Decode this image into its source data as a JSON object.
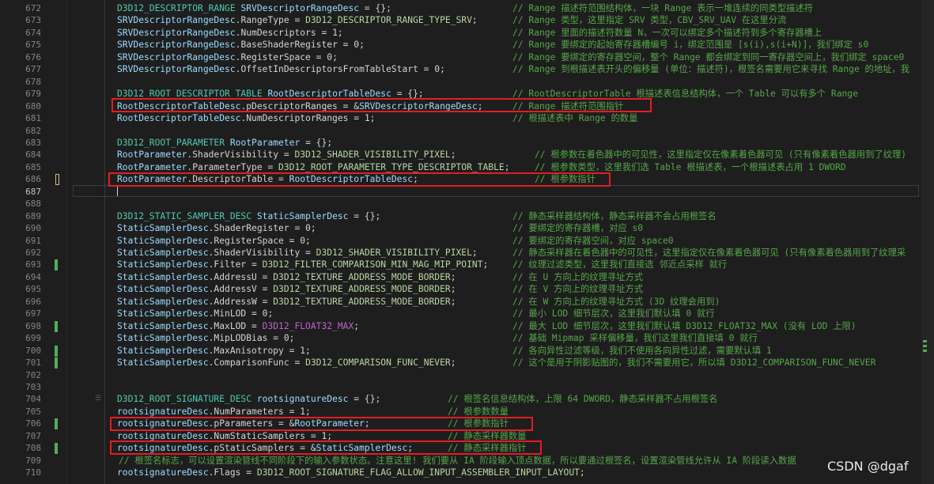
{
  "editor": {
    "lines": [
      {
        "n": "672",
        "tokens": [
          {
            "t": "D3D12_DESCRIPTOR_RANGE",
            "c": "type"
          },
          {
            "t": " "
          },
          {
            "t": "SRVDescriptorRangeDesc",
            "c": "def"
          },
          {
            "t": " = {};"
          }
        ],
        "comment": "// Range 描述符范围结构体，一块 Range 表示一堆连续的同类型描述符"
      },
      {
        "n": "673",
        "tokens": [
          {
            "t": "SRVDescriptorRangeDesc",
            "c": "var"
          },
          {
            "t": ".RangeType = "
          },
          {
            "t": "D3D12_DESCRIPTOR_RANGE_TYPE_SRV",
            "c": "const"
          },
          {
            "t": ";"
          }
        ],
        "comment": "// Range 类型，这里指定 SRV 类型，CBV_SRV_UAV 在这里分流"
      },
      {
        "n": "674",
        "tokens": [
          {
            "t": "SRVDescriptorRangeDesc",
            "c": "var"
          },
          {
            "t": ".NumDescriptors = 1;"
          }
        ],
        "comment": "// Range 里面的描述符数量 N，一次可以绑定多个描述符到多个寄存器槽上"
      },
      {
        "n": "675",
        "tokens": [
          {
            "t": "SRVDescriptorRangeDesc",
            "c": "var"
          },
          {
            "t": ".BaseShaderRegister = 0;"
          }
        ],
        "comment": "// Range 要绑定的起始寄存器槽编号 i，绑定范围是 [s(i),s(i+N)]，我们绑定 s0"
      },
      {
        "n": "676",
        "tokens": [
          {
            "t": "SRVDescriptorRangeDesc",
            "c": "var"
          },
          {
            "t": ".RegisterSpace = 0;"
          }
        ],
        "comment": "// Range 要绑定的寄存器空间，整个 Range 都会绑定到同一寄存器空间上，我们绑定 space0"
      },
      {
        "n": "677",
        "tokens": [
          {
            "t": "SRVDescriptorRangeDesc",
            "c": "var"
          },
          {
            "t": ".OffsetInDescriptorsFromTableStart = 0;"
          }
        ],
        "comment": "// Range 到根描述表开头的偏移量 (单位：描述符)，根签名需要用它来寻找 Range 的地址，我"
      },
      {
        "n": "678",
        "tokens": [],
        "comment": ""
      },
      {
        "n": "679",
        "tokens": [
          {
            "t": "D3D12_ROOT_DESCRIPTOR_TABLE",
            "c": "type"
          },
          {
            "t": " "
          },
          {
            "t": "RootDescriptorTableDesc",
            "c": "def"
          },
          {
            "t": " = {};"
          }
        ],
        "comment": "// RootDescriptorTable 根描述表信息结构体，一个 Table 可以有多个 Range"
      },
      {
        "n": "680",
        "tokens": [
          {
            "t": "RootDescriptorTableDesc",
            "c": "var"
          },
          {
            "t": ".pDescriptorRanges = &"
          },
          {
            "t": "SRVDescriptorRangeDesc",
            "c": "var"
          },
          {
            "t": ";"
          }
        ],
        "comment": "// Range 描述符范围指针"
      },
      {
        "n": "681",
        "tokens": [
          {
            "t": "RootDescriptorTableDesc",
            "c": "var"
          },
          {
            "t": ".NumDescriptorRanges = 1;"
          }
        ],
        "comment": "// 根描述表中 Range 的数量"
      },
      {
        "n": "682",
        "tokens": [],
        "comment": ""
      },
      {
        "n": "683",
        "tokens": [
          {
            "t": "D3D12_ROOT_PARAMETER",
            "c": "type"
          },
          {
            "t": " "
          },
          {
            "t": "RootParameter",
            "c": "def"
          },
          {
            "t": " = {};"
          }
        ],
        "comment": ""
      },
      {
        "n": "684",
        "tokens": [
          {
            "t": "RootParameter",
            "c": "var"
          },
          {
            "t": ".ShaderVisibility = "
          },
          {
            "t": "D3D12_SHADER_VISIBILITY_PIXEL",
            "c": "const"
          },
          {
            "t": ";"
          }
        ],
        "comment": "// 根参数在着色器中的可见性，这里指定仅在像素着色器可见 (只有像素着色器用到了纹理)"
      },
      {
        "n": "685",
        "tokens": [
          {
            "t": "RootParameter",
            "c": "var"
          },
          {
            "t": ".ParameterType = "
          },
          {
            "t": "D3D12_ROOT_PARAMETER_TYPE_DESCRIPTOR_TABLE",
            "c": "const"
          },
          {
            "t": ";"
          }
        ],
        "comment": "// 根参数类型，这里我们选 Table 根描述表，一个根描述表占用 1 DWORD"
      },
      {
        "n": "686",
        "tokens": [
          {
            "t": "RootParameter",
            "c": "var"
          },
          {
            "t": ".DescriptorTable = "
          },
          {
            "t": "RootDescriptorTableDesc",
            "c": "var"
          },
          {
            "t": ";"
          }
        ],
        "comment": "// 根参数指针"
      },
      {
        "n": "687",
        "tokens": [],
        "comment": ""
      },
      {
        "n": "688",
        "tokens": [],
        "comment": ""
      },
      {
        "n": "689",
        "tokens": [
          {
            "t": "D3D12_STATIC_SAMPLER_DESC",
            "c": "type"
          },
          {
            "t": " "
          },
          {
            "t": "StaticSamplerDesc",
            "c": "def"
          },
          {
            "t": " = {};"
          }
        ],
        "comment": "// 静态采样器结构体，静态采样器不会占用根签名"
      },
      {
        "n": "690",
        "tokens": [
          {
            "t": "StaticSamplerDesc",
            "c": "var"
          },
          {
            "t": ".ShaderRegister = 0;"
          }
        ],
        "comment": "// 要绑定的寄存器槽，对应 s0"
      },
      {
        "n": "691",
        "tokens": [
          {
            "t": "StaticSamplerDesc",
            "c": "var"
          },
          {
            "t": ".RegisterSpace = 0;"
          }
        ],
        "comment": "// 要绑定的寄存器空间，对应 space0"
      },
      {
        "n": "692",
        "tokens": [
          {
            "t": "StaticSamplerDesc",
            "c": "var"
          },
          {
            "t": ".ShaderVisibility = "
          },
          {
            "t": "D3D12_SHADER_VISIBILITY_PIXEL",
            "c": "const"
          },
          {
            "t": ";"
          }
        ],
        "comment": "// 静态采样器在着色器中的可见性，这里指定仅在像素着色器可见 (只有像素着色器用到了纹理采"
      },
      {
        "n": "693",
        "tokens": [
          {
            "t": "StaticSamplerDesc",
            "c": "var"
          },
          {
            "t": ".Filter = "
          },
          {
            "t": "D3D12_FILTER_COMPARISON_MIN_MAG_MIP_POINT",
            "c": "const"
          },
          {
            "t": ";"
          }
        ],
        "comment": "// 纹理过滤类型，这里我们直接选 邻近点采样 就行"
      },
      {
        "n": "694",
        "tokens": [
          {
            "t": "StaticSamplerDesc",
            "c": "var"
          },
          {
            "t": ".AddressU = "
          },
          {
            "t": "D3D12_TEXTURE_ADDRESS_MODE_BORDER",
            "c": "const"
          },
          {
            "t": ";"
          }
        ],
        "comment": "// 在 U 方向上的纹理寻址方式"
      },
      {
        "n": "695",
        "tokens": [
          {
            "t": "StaticSamplerDesc",
            "c": "var"
          },
          {
            "t": ".AddressV = "
          },
          {
            "t": "D3D12_TEXTURE_ADDRESS_MODE_BORDER",
            "c": "const"
          },
          {
            "t": ";"
          }
        ],
        "comment": "// 在 V 方向上的纹理寻址方式"
      },
      {
        "n": "696",
        "tokens": [
          {
            "t": "StaticSamplerDesc",
            "c": "var"
          },
          {
            "t": ".AddressW = "
          },
          {
            "t": "D3D12_TEXTURE_ADDRESS_MODE_BORDER",
            "c": "const"
          },
          {
            "t": ";"
          }
        ],
        "comment": "// 在 W 方向上的纹理寻址方式 (3D 纹理会用到)"
      },
      {
        "n": "697",
        "tokens": [
          {
            "t": "StaticSamplerDesc",
            "c": "var"
          },
          {
            "t": ".MinLOD = 0;"
          }
        ],
        "comment": "// 最小 LOD 细节层次，这里我们默认填 0 就行"
      },
      {
        "n": "698",
        "tokens": [
          {
            "t": "StaticSamplerDesc",
            "c": "var"
          },
          {
            "t": ".MaxLOD = "
          },
          {
            "t": "D3D12_FLOAT32_MAX",
            "c": "macro"
          },
          {
            "t": ";"
          }
        ],
        "comment": "// 最大 LOD 细节层次，这里我们默认填 D3D12_FLOAT32_MAX (没有 LOD 上限)"
      },
      {
        "n": "699",
        "tokens": [
          {
            "t": "StaticSamplerDesc",
            "c": "var"
          },
          {
            "t": ".MipLODBias = 0;"
          }
        ],
        "comment": "// 基础 Mipmap 采样偏移量，我们这里我们直接填 0 就行"
      },
      {
        "n": "700",
        "tokens": [
          {
            "t": "StaticSamplerDesc",
            "c": "var"
          },
          {
            "t": ".MaxAnisotropy = 1;"
          }
        ],
        "comment": "// 各向异性过滤等级，我们不使用各向异性过滤，需要默认填 1"
      },
      {
        "n": "701",
        "tokens": [
          {
            "t": "StaticSamplerDesc",
            "c": "var"
          },
          {
            "t": ".ComparisonFunc = "
          },
          {
            "t": "D3D12_COMPARISON_FUNC_NEVER",
            "c": "const"
          },
          {
            "t": ";"
          }
        ],
        "comment": "// 这个是用于阴影贴图的，我们不需要用它，所以填 D3D12_COMPARISON_FUNC_NEVER"
      },
      {
        "n": "702",
        "tokens": [],
        "comment": ""
      },
      {
        "n": "703",
        "tokens": [],
        "comment": ""
      },
      {
        "n": "704",
        "tokens": [
          {
            "t": "D3D12_ROOT_SIGNATURE_DESC",
            "c": "type"
          },
          {
            "t": " "
          },
          {
            "t": "rootsignatureDesc",
            "c": "def"
          },
          {
            "t": " = {};"
          }
        ],
        "comment": "// 根签名信息结构体，上限 64 DWORD，静态采样器不占用根签名"
      },
      {
        "n": "705",
        "tokens": [
          {
            "t": "rootsignatureDesc",
            "c": "var"
          },
          {
            "t": ".NumParameters = 1;"
          }
        ],
        "comment": "// 根参数数量"
      },
      {
        "n": "706",
        "tokens": [
          {
            "t": "rootsignatureDesc",
            "c": "var"
          },
          {
            "t": ".pParameters = &"
          },
          {
            "t": "RootParameter",
            "c": "var"
          },
          {
            "t": ";"
          }
        ],
        "comment": "// 根参数指针"
      },
      {
        "n": "707",
        "tokens": [
          {
            "t": "rootsignatureDesc",
            "c": "var"
          },
          {
            "t": ".NumStaticSamplers = 1;"
          }
        ],
        "comment": "// 静态采样器数量"
      },
      {
        "n": "708",
        "tokens": [
          {
            "t": "rootsignatureDesc",
            "c": "var"
          },
          {
            "t": ".pStaticSamplers = &"
          },
          {
            "t": "StaticSamplerDesc",
            "c": "var"
          },
          {
            "t": ";"
          }
        ],
        "comment": "// 静态采样器指针"
      },
      {
        "n": "709",
        "tokens": [],
        "comment": "// 根签名标志，可以设置渲染管线不同阶段下的输入参数状态。注意这里! 我们要从 IA 阶段输入顶点数据，所以要通过根签名，设置渲染管线允许从 IA 阶段读入数据"
      },
      {
        "n": "710",
        "tokens": [
          {
            "t": "rootsignatureDesc",
            "c": "var"
          },
          {
            "t": ".Flags = "
          },
          {
            "t": "D3D12_ROOT_SIGNATURE_FLAG_ALLOW_INPUT_ASSEMBLER_INPUT_LAYOUT",
            "c": "const"
          },
          {
            "t": ";"
          }
        ],
        "comment": ""
      }
    ],
    "current_line": "687",
    "watermark": "CSDN @dgaf"
  },
  "colors": {
    "background": "#1e1e1e",
    "comment": "#57a64a",
    "type": "#4ec9b0",
    "variable": "#9cdcfe",
    "highlight_box": "#e51c23",
    "change_marker": "#57ab5a"
  }
}
